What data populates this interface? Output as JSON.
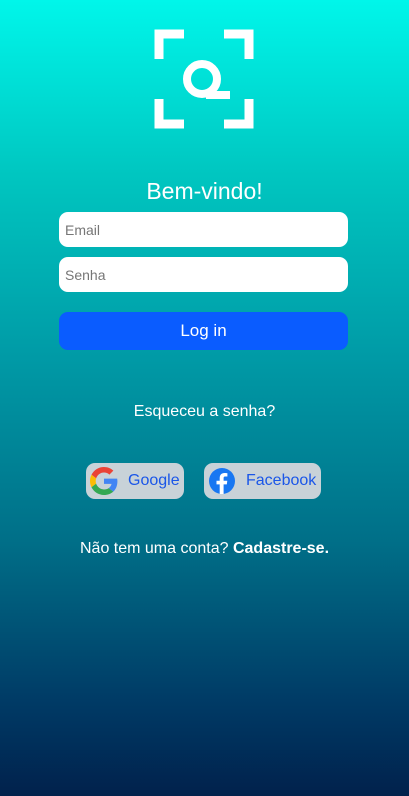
{
  "colors": {
    "primary_button": "#0a5cff",
    "social_button_bg": "#c8d2d8",
    "social_text": "#1a56e8",
    "gradient_top": "#00f6ea",
    "gradient_bottom": "#01214c"
  },
  "logo": {
    "icon": "scan-q-logo-icon"
  },
  "welcome": {
    "title": "Bem-vindo!"
  },
  "form": {
    "email_placeholder": "Email",
    "email_value": "",
    "password_placeholder": "Senha",
    "password_value": "",
    "login_label": "Log in"
  },
  "forgot": {
    "label": "Esqueceu a senha?"
  },
  "social": {
    "google": {
      "label": "Google",
      "icon": "google-icon"
    },
    "facebook": {
      "label": "Facebook",
      "icon": "facebook-icon"
    }
  },
  "signup": {
    "prompt": "Não tem uma conta?",
    "link": "Cadastre-se."
  }
}
